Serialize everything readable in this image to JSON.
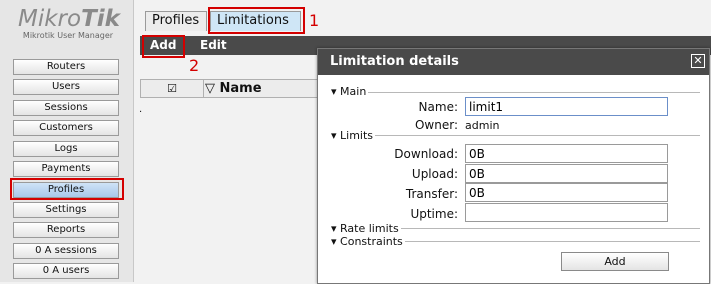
{
  "logo": {
    "brand_regular": "Mikro",
    "brand_bold": "Tik",
    "subtitle": "Mikrotik User Manager"
  },
  "sidebar": {
    "items": [
      {
        "label": "Routers"
      },
      {
        "label": "Users"
      },
      {
        "label": "Sessions"
      },
      {
        "label": "Customers"
      },
      {
        "label": "Logs"
      },
      {
        "label": "Payments"
      },
      {
        "label": "Profiles",
        "active": true
      },
      {
        "label": "Settings"
      },
      {
        "label": "Reports"
      },
      {
        "label": "0 A sessions"
      },
      {
        "label": "0 A users"
      }
    ]
  },
  "tabs": [
    {
      "label": "Profiles",
      "active": false
    },
    {
      "label": "Limitations",
      "active": true
    }
  ],
  "toolbar": {
    "add_label": "Add",
    "edit_label": "Edit"
  },
  "table": {
    "check_header": "☑",
    "name_header": "Name",
    "sort_icon": "▽",
    "row_placeholder": "."
  },
  "dialog": {
    "title": "Limitation details",
    "close_icon": "✕",
    "sections": {
      "main": "Main",
      "limits": "Limits",
      "rate_limits": "Rate limits",
      "constraints": "Constraints"
    },
    "fields": {
      "name_label": "Name:",
      "name_value": "limit1",
      "owner_label": "Owner:",
      "owner_value": "admin",
      "download_label": "Download:",
      "download_value": "0B",
      "upload_label": "Upload:",
      "upload_value": "0B",
      "transfer_label": "Transfer:",
      "transfer_value": "0B",
      "uptime_label": "Uptime:",
      "uptime_value": ""
    },
    "add_button": "Add"
  },
  "annotations": {
    "step1": "1",
    "step2": "2"
  },
  "colors": {
    "toolbar_bg": "#4a4a4a",
    "active_tab": "#cfe6f6",
    "annotation_red": "#d40000"
  }
}
